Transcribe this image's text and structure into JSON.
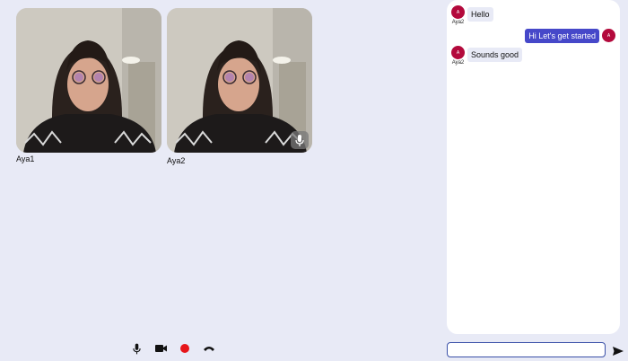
{
  "participants": [
    {
      "name": "Aya1"
    },
    {
      "name": "Aya2"
    }
  ],
  "controls": {
    "mic_icon": "microphone-icon",
    "camera_icon": "video-camera-icon",
    "record_icon": "record-icon",
    "hangup_icon": "phone-hangup-icon",
    "record_color": "#e6151a"
  },
  "chat": {
    "messages": [
      {
        "direction": "incoming",
        "avatar_initial": "A",
        "sender": "Aya2",
        "text": "Hello"
      },
      {
        "direction": "outgoing",
        "avatar_initial": "A",
        "text": "Hi Let's get started"
      },
      {
        "direction": "incoming",
        "avatar_initial": "A",
        "sender": "Aya2",
        "text": "Sounds good"
      }
    ],
    "input_value": "",
    "send_icon": "send-icon"
  },
  "colors": {
    "background": "#e8eaf6",
    "outgoing_bubble": "#4648c9",
    "incoming_bubble": "#e8eaf6",
    "avatar": "#b3093c"
  }
}
